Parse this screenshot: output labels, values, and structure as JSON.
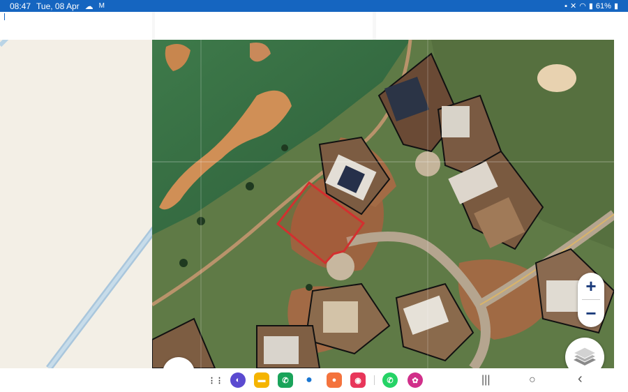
{
  "status_bar": {
    "time": "08:47",
    "date": "Tue, 08 Apr",
    "battery": "61%"
  },
  "map": {
    "zoom_in_label": "+",
    "zoom_out_label": "−",
    "highlight_color": "#d32f2f"
  },
  "dock": {
    "apps": [
      "apps-grid",
      "samsung-internet",
      "my-files",
      "phone",
      "messages",
      "contacts",
      "screen-recorder",
      "whatsapp",
      "flower-app"
    ]
  },
  "nav": {
    "recents_icon": "|||",
    "home_icon": "○",
    "back_icon": "‹"
  },
  "colors": {
    "status_bar": "#1565c0",
    "zoom_icon": "#1a3a7a"
  }
}
